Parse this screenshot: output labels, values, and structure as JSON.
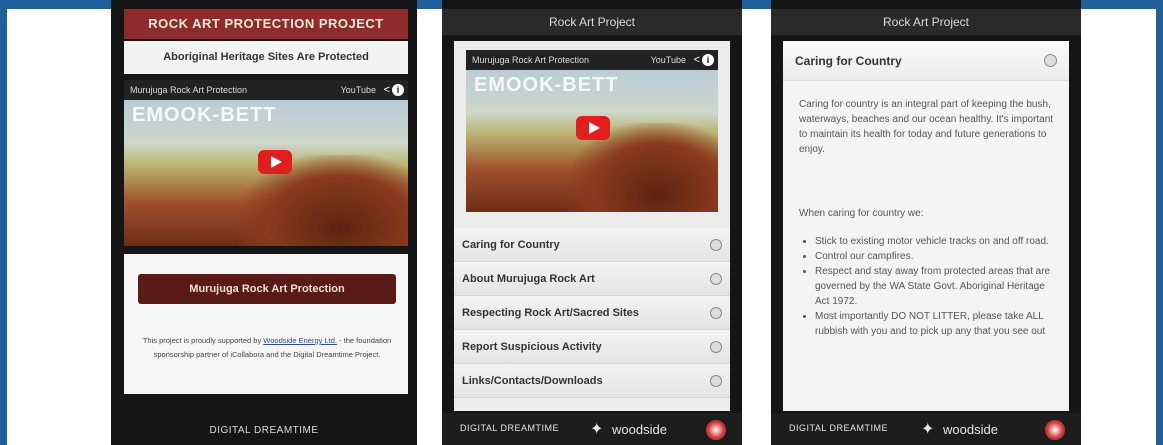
{
  "phone1": {
    "banner": "ROCK ART PROTECTION PROJECT",
    "subtitle": "Aboriginal Heritage Sites Are Protected",
    "video": {
      "title": "Murujuga Rock Art Protection",
      "source": "YouTube",
      "overlay_text": "EMOOK-BETT"
    },
    "button_label": "Murujuga Rock Art Protection",
    "support_text_before": "This project is proudly supported by ",
    "support_link": "Woodside Energy Ltd.",
    "support_text_after": " - the foundation sponsorship partner of iCollabora and the Digital Dreamtime Project.",
    "footer": "DIGITAL DREAMTIME"
  },
  "phone2": {
    "header": "Rock Art Project",
    "video": {
      "title": "Murujuga Rock Art Protection",
      "source": "YouTube",
      "overlay_text": "EMOOK-BETT"
    },
    "menu": [
      {
        "label": "Caring for Country"
      },
      {
        "label": "About Murujuga Rock Art"
      },
      {
        "label": "Respecting Rock Art/Sacred Sites"
      },
      {
        "label": "Report Suspicious Activity"
      },
      {
        "label": "Links/Contacts/Downloads"
      }
    ],
    "footer": {
      "left": "DIGITAL DREAMTIME",
      "right": "woodside"
    }
  },
  "phone3": {
    "header": "Rock Art Project",
    "section_title": "Caring for Country",
    "para1": "Caring for country is an integral part of keeping the bush, waterways, beaches and our ocean healthy. It's important to maintain its health for today and future generations to enjoy.",
    "para2": "When caring for country we:",
    "bullets": [
      "Stick to existing motor vehicle tracks on and off road.",
      "Control our campfires.",
      "Respect and stay away from protected areas that are governed by the WA State Govt. Aboriginal Heritage Act 1972.",
      "Most importantly DO NOT LITTER, please take ALL rubbish with you and to pick up any that you see out"
    ],
    "footer": {
      "left": "DIGITAL DREAMTIME",
      "right": "woodside"
    }
  },
  "colors": {
    "frame_blue": "#1f5f9a",
    "banner_red": "#8e2b2b",
    "button_maroon": "#5a1a17",
    "youtube_red": "#e21d1d"
  },
  "icons": [
    "share-icon",
    "info-icon",
    "play-icon",
    "plus-icon",
    "minus-icon",
    "woodside-logo-icon",
    "roundel-logo-icon"
  ]
}
